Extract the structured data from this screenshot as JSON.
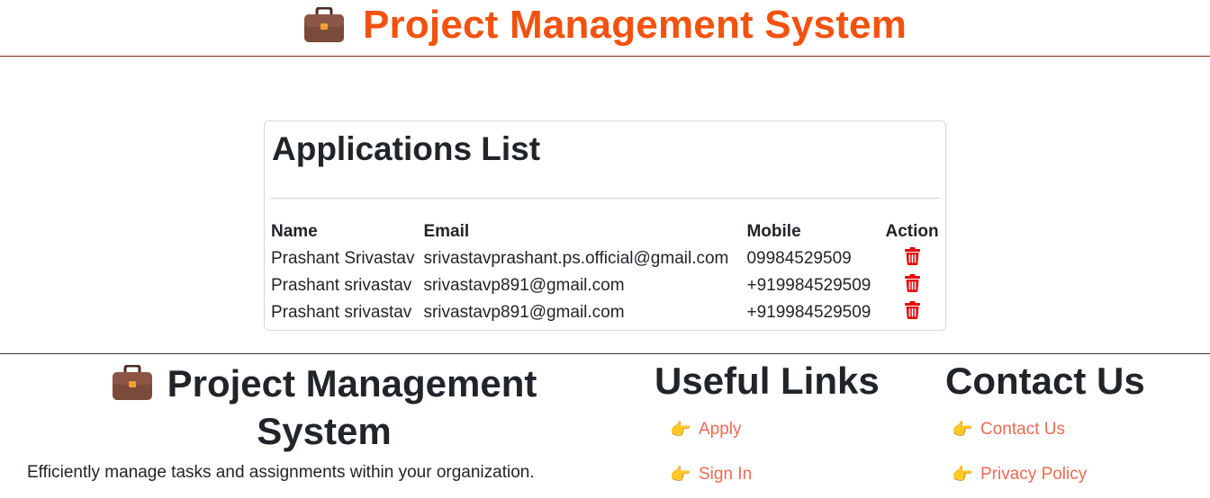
{
  "header": {
    "title": "Project Management System",
    "icon": "briefcase-icon",
    "title_color": "#f2520f"
  },
  "card": {
    "title": "Applications List",
    "columns": {
      "name": "Name",
      "email": "Email",
      "mobile": "Mobile",
      "action": "Action"
    },
    "rows": [
      {
        "name": "Prashant Srivastav",
        "email": "srivastavprashant.ps.official@gmail.com",
        "mobile": "09984529509",
        "action_icon": "trash-icon"
      },
      {
        "name": "Prashant srivastav",
        "email": "srivastavp891@gmail.com",
        "mobile": "+919984529509",
        "action_icon": "trash-icon"
      },
      {
        "name": "Prashant srivastav",
        "email": "srivastavp891@gmail.com",
        "mobile": "+919984529509",
        "action_icon": "trash-icon"
      }
    ],
    "delete_color": "#e60000"
  },
  "footer": {
    "brand_title": "Project Management System",
    "brand_icon": "briefcase-icon",
    "description": "Efficiently manage tasks and assignments within your organization.",
    "useful_links": {
      "heading": "Useful Links",
      "items": [
        {
          "label": "Apply",
          "icon": "pointing-hand-icon"
        },
        {
          "label": "Sign In",
          "icon": "pointing-hand-icon"
        }
      ]
    },
    "contact": {
      "heading": "Contact Us",
      "items": [
        {
          "label": "Contact Us",
          "icon": "pointing-hand-icon"
        },
        {
          "label": "Privacy Policy",
          "icon": "pointing-hand-icon"
        }
      ]
    },
    "link_color": "#ee6a50"
  }
}
